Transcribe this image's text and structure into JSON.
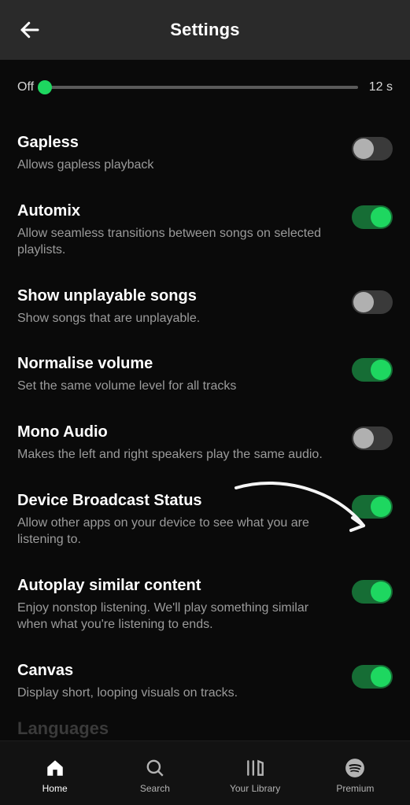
{
  "header": {
    "title": "Settings"
  },
  "slider": {
    "left_label": "Off",
    "right_label": "12 s",
    "value_pct": 0
  },
  "settings": [
    {
      "title": "Gapless",
      "desc": "Allows gapless playback",
      "on": false
    },
    {
      "title": "Automix",
      "desc": "Allow seamless transitions between songs on selected playlists.",
      "on": true
    },
    {
      "title": "Show unplayable songs",
      "desc": "Show songs that are unplayable.",
      "on": false
    },
    {
      "title": "Normalise volume",
      "desc": "Set the same volume level for all tracks",
      "on": true
    },
    {
      "title": "Mono Audio",
      "desc": "Makes the left and right speakers play the same audio.",
      "on": false
    },
    {
      "title": "Device Broadcast Status",
      "desc": "Allow other apps on your device to see what you are listening to.",
      "on": true
    },
    {
      "title": "Autoplay similar content",
      "desc": "Enjoy nonstop listening. We'll play something similar when what you're listening to ends.",
      "on": true
    },
    {
      "title": "Canvas",
      "desc": "Display short, looping visuals on tracks.",
      "on": true
    }
  ],
  "ghost_section": "Languages",
  "nav": {
    "items": [
      {
        "id": "home",
        "label": "Home",
        "active": true
      },
      {
        "id": "search",
        "label": "Search",
        "active": false
      },
      {
        "id": "library",
        "label": "Your Library",
        "active": false
      },
      {
        "id": "premium",
        "label": "Premium",
        "active": false
      }
    ]
  }
}
